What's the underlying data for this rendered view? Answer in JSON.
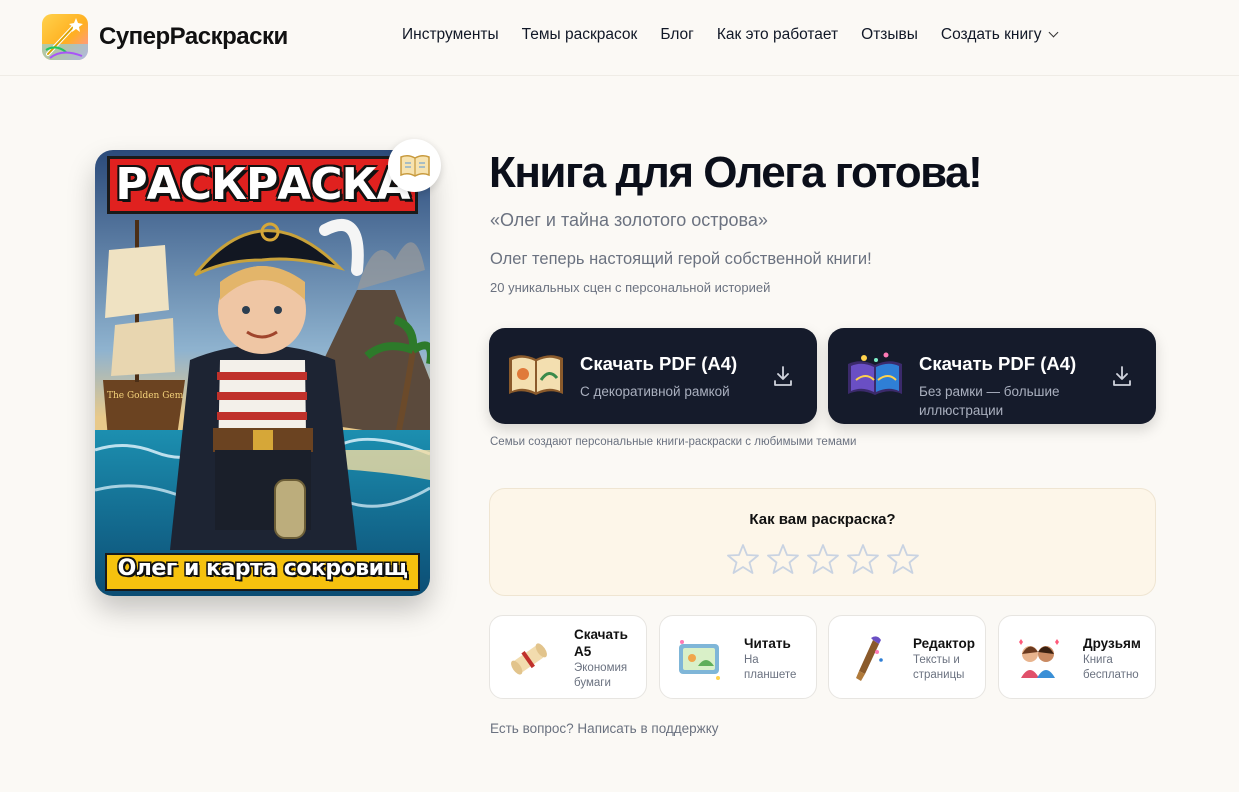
{
  "header": {
    "brand": "СуперРаскраски",
    "logo_icon": "magic-wand-logo-icon",
    "nav": [
      {
        "label": "Инструменты"
      },
      {
        "label": "Темы раскрасок"
      },
      {
        "label": "Блог"
      },
      {
        "label": "Как это работает"
      },
      {
        "label": "Отзывы"
      },
      {
        "label": "Создать книгу",
        "icon": "chevron-down-icon"
      }
    ]
  },
  "cover": {
    "title": "РАСКРАСКА",
    "subtitle": "Олег и карта сокровищ",
    "ship_text": "The Golden Gem Anchor",
    "badge_icon": "open-book-icon"
  },
  "main": {
    "heading": "Книга для Олега готова!",
    "book_title": "«Олег и тайна золотого острова»",
    "tagline": "Олег теперь настоящий герой собственной книги!",
    "scenes": "20 уникальных сцен с персональной историей",
    "download_frame": {
      "title": "Скачать PDF (A4)",
      "desc": "С декоративной рамкой"
    },
    "download_noframe": {
      "title": "Скачать PDF (A4)",
      "desc": "Без рамки — большие иллюстрации"
    },
    "note": "Семьи создают персональные книги-раскраски с любимыми темами"
  },
  "rating": {
    "question": "Как вам раскраска?",
    "max_stars": 5,
    "selected": 0
  },
  "cards": [
    {
      "title": "Скачать A5",
      "desc": "Экономия бумаги",
      "icon": "scroll-icon"
    },
    {
      "title": "Читать",
      "desc": "На планшете",
      "icon": "tablet-icon"
    },
    {
      "title": "Редактор",
      "desc": "Тексты и страницы",
      "icon": "brush-icon"
    },
    {
      "title": "Друзьям",
      "desc": "Книга бесплатно",
      "icon": "friends-icon"
    }
  ],
  "support": "Есть вопрос? Написать в поддержку",
  "colors": {
    "background": "#fbf9f5",
    "button_dark": "#151b2b",
    "rating_bg": "#fdf6e9",
    "cover_red": "#e0211f",
    "cover_yellow": "#f6c20e"
  }
}
